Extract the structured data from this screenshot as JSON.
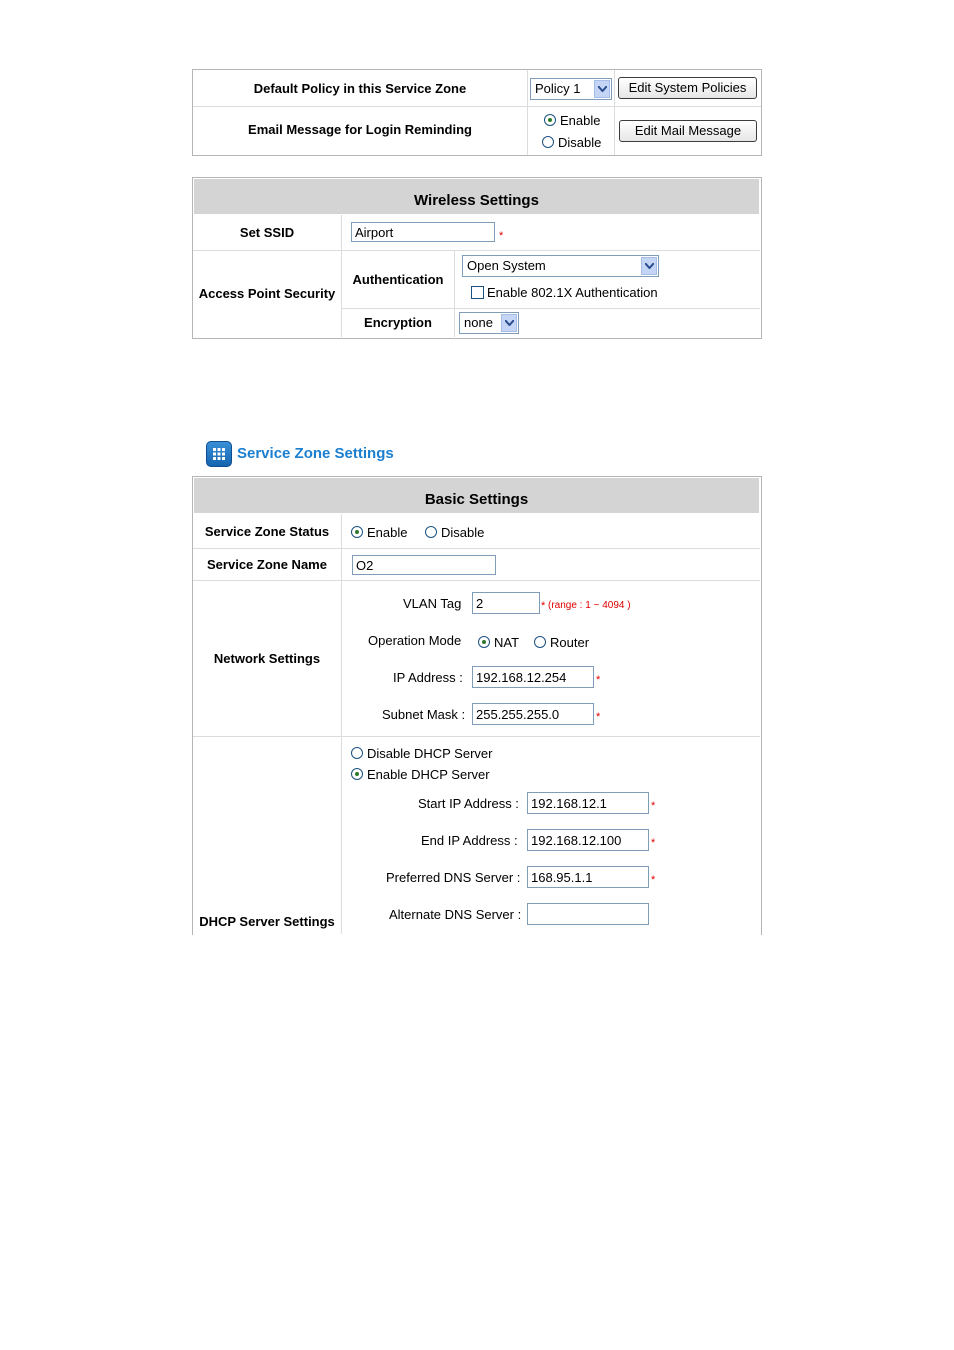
{
  "zone_policy": {
    "default_policy_label": "Default Policy in this Service Zone",
    "policy_value": "Policy 1",
    "edit_policies_button": "Edit System Policies",
    "email_label": "Email Message for Login Reminding",
    "enable_label": "Enable",
    "disable_label": "Disable",
    "edit_mail_button": "Edit Mail Message"
  },
  "wireless": {
    "title": "Wireless Settings",
    "ssid_label": "Set SSID",
    "ssid_value": "Airport",
    "ap_security_label": "Access Point Security",
    "authentication_label": "Authentication",
    "authentication_value": "Open System",
    "dot1x_label": "Enable 802.1X Authentication",
    "encryption_label": "Encryption",
    "encryption_value": "none"
  },
  "section_title": "Service Zone Settings",
  "basic": {
    "title": "Basic Settings",
    "status_label": "Service Zone Status",
    "enable_label": "Enable",
    "disable_label": "Disable",
    "name_label": "Service Zone Name",
    "name_value": "O2",
    "network_label": "Network Settings",
    "vlan_label": "VLAN Tag",
    "vlan_value": "2",
    "vlan_range": "(range : 1 ~ 4094 )",
    "operation_mode_label": "Operation Mode",
    "nat_label": "NAT",
    "router_label": "Router",
    "ip_label": "IP Address :",
    "ip_value": "192.168.12.254",
    "mask_label": "Subnet Mask :",
    "mask_value": "255.255.255.0",
    "dhcp_label": "DHCP Server Settings",
    "disable_dhcp_label": "Disable DHCP Server",
    "enable_dhcp_label": "Enable DHCP Server",
    "start_ip_label": "Start IP Address :",
    "start_ip_value": "192.168.12.1",
    "end_ip_label": "End IP Address :",
    "end_ip_value": "192.168.12.100",
    "pref_dns_label": "Preferred DNS Server :",
    "pref_dns_value": "168.95.1.1",
    "alt_dns_label": "Alternate DNS Server :",
    "alt_dns_value": ""
  },
  "required_mark": "*"
}
